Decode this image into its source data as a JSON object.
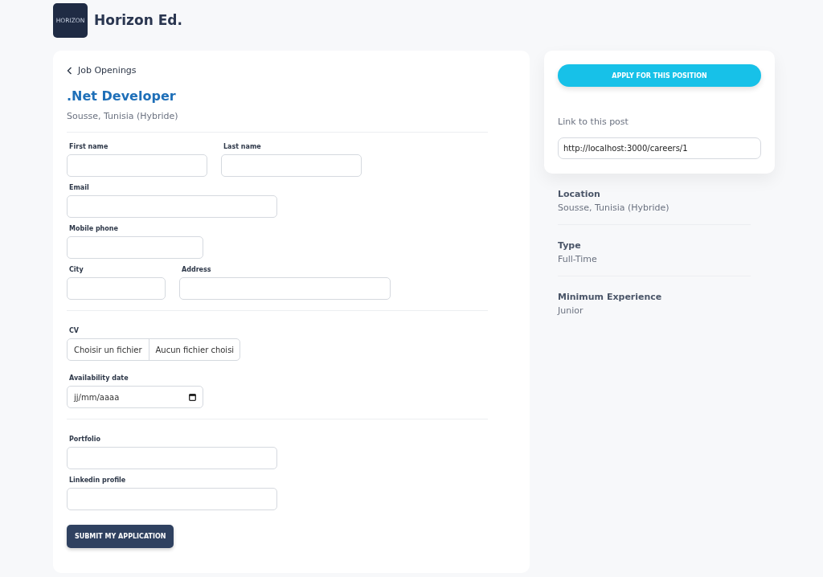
{
  "header": {
    "logo_text": "HORIZON",
    "brand": "Horizon Ed."
  },
  "job": {
    "back_link": "Job Openings",
    "title": ".Net Developer",
    "location": "Sousse, Tunisia (Hybride)"
  },
  "form": {
    "sections": [
      {
        "rows": [
          [
            {
              "label": "First name",
              "kind": "text"
            },
            {
              "label": "Last name",
              "kind": "text"
            }
          ],
          [
            {
              "label": "Email",
              "kind": "text"
            }
          ],
          [
            {
              "label": "Mobile phone",
              "kind": "text"
            }
          ],
          [
            {
              "label": "City",
              "kind": "text"
            },
            {
              "label": "Address",
              "kind": "text"
            }
          ]
        ]
      },
      {
        "rows": [
          [
            {
              "label": "CV",
              "kind": "file",
              "button": "Choisir un fichier",
              "status": "Aucun fichier choisi"
            }
          ],
          [
            {
              "label": "Availability date",
              "kind": "date",
              "placeholder": "jj/mm/aaaa"
            }
          ]
        ]
      },
      {
        "rows": [
          [
            {
              "label": "Portfolio",
              "kind": "text"
            }
          ],
          [
            {
              "label": "Linkedin profile",
              "kind": "text"
            }
          ]
        ]
      }
    ],
    "submit": "SUBMIT MY APPLICATION"
  },
  "apply": {
    "button": "APPLY FOR THIS POSITION",
    "link_label": "Link to this post",
    "link_value": "http://localhost:3000/careers/1"
  },
  "details": [
    {
      "label": "Location",
      "value": "Sousse, Tunisia (Hybride)"
    },
    {
      "label": "Type",
      "value": "Full-Time"
    },
    {
      "label": "Minimum Experience",
      "value": "Junior"
    }
  ]
}
